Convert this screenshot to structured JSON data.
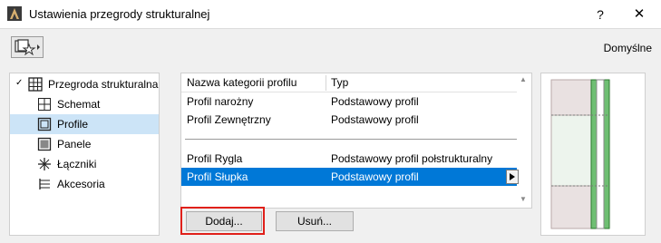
{
  "window": {
    "title": "Ustawienia przegrody strukturalnej",
    "help": "?",
    "close": "✕"
  },
  "header": {
    "defaults_label": "Domyślne"
  },
  "tree": {
    "root": "Przegroda strukturalna",
    "items": [
      {
        "label": "Schemat"
      },
      {
        "label": "Profile"
      },
      {
        "label": "Panele"
      },
      {
        "label": "Łączniki"
      },
      {
        "label": "Akcesoria"
      }
    ]
  },
  "profile_list": {
    "columns": [
      "Nazwa kategorii profilu",
      "Typ"
    ],
    "rows": [
      {
        "name": "Profil narożny",
        "type": "Podstawowy profil"
      },
      {
        "name": "Profil Zewnętrzny",
        "type": "Podstawowy profil"
      },
      {
        "name": "Profil Rygla",
        "type": "Podstawowy profil połstrukturalny"
      },
      {
        "name": "Profil Słupka",
        "type": "Podstawowy profil"
      }
    ]
  },
  "buttons": {
    "add": "Dodaj...",
    "remove": "Usuń..."
  },
  "colors": {
    "selection": "#0078d7",
    "highlight": "#e0201a",
    "tree_selection": "#cce4f7"
  }
}
